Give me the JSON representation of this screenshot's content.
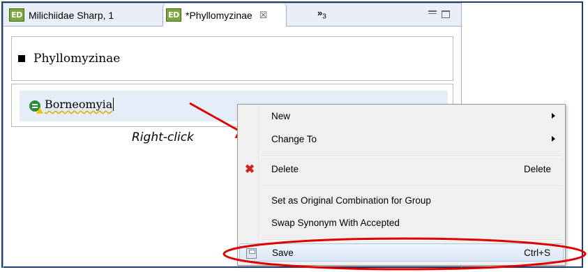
{
  "tabs": [
    {
      "icon": "ED",
      "label": "Milichiidae Sharp, 1",
      "active": false
    },
    {
      "icon": "ED",
      "label": "*Phyllomyzinae",
      "active": true,
      "close": "☒"
    }
  ],
  "tab_overflow": {
    "chevron": "»",
    "count": "3"
  },
  "editor": {
    "group_title": "Phyllomyzinae",
    "taxon_name": "Borneomyia"
  },
  "annotation": {
    "text": "Right-click",
    "color": "#e00000"
  },
  "context_menu": {
    "new_label": "New",
    "change_to_label": "Change To",
    "delete_label": "Delete",
    "delete_shortcut": "Delete",
    "set_original_label": "Set as Original Combination for Group",
    "swap_label": "Swap Synonym With Accepted",
    "save_label": "Save",
    "save_shortcut": "Ctrl+S"
  },
  "colors": {
    "frame_border": "#1f3f6e",
    "highlight_ring": "#e00000",
    "menu_hover": "#dbe8f7"
  },
  "icons": {
    "editor_tab": "ed-editor-icon",
    "taxon": "accepted-taxon-icon",
    "warning": "warning-icon",
    "delete": "red-x-icon",
    "save": "floppy-disk-icon"
  }
}
